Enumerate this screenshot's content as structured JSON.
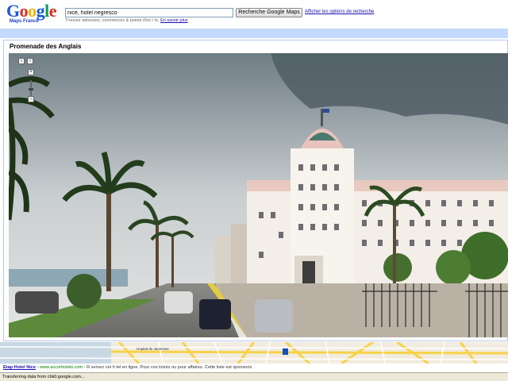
{
  "header": {
    "logo_text": "Google",
    "logo_subtitle": "Maps France",
    "search_value": "nice, hotel negresco",
    "search_button_label": "Recherche Google Maps",
    "options_link": "Afficher les options de recherche",
    "hint_text": "Trouvez adresses, commerces & points d'int r ts.",
    "hint_link": "En savoir plus"
  },
  "panel": {
    "title": "Promenade des Anglais"
  },
  "map": {
    "place_label": "Hopital de Jeunesse"
  },
  "ad": {
    "title": "Etap Hotel Nice",
    "separator": " - ",
    "url": "www.accorhotels.com",
    "description": " - R servez cet h tel en ligne. Pour vos loisirs ou pour affaires. Cette liste est sponsoris"
  },
  "status_bar": {
    "text": "Transferring data from cbk0.google.com..."
  },
  "colors": {
    "bluebar": "#c3d9ff",
    "link": "#1a0dab",
    "ad_url": "#008000"
  }
}
